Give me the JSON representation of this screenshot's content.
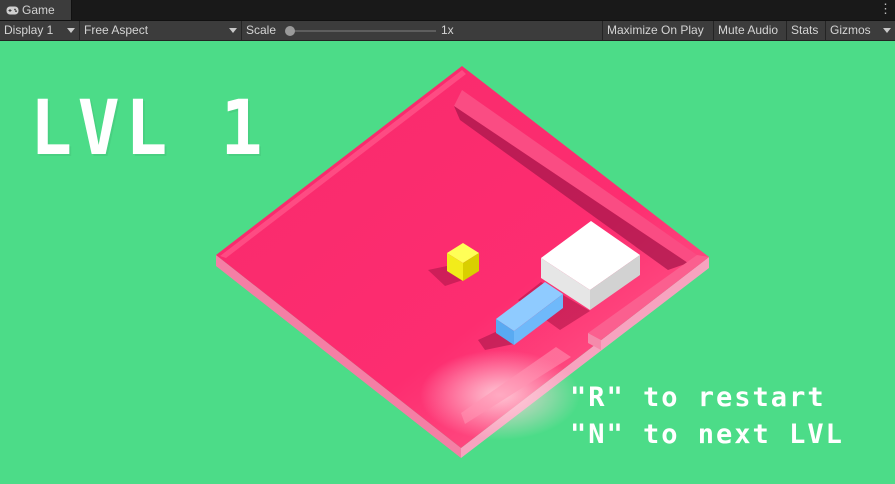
{
  "window": {
    "tab_label": "Game",
    "tab_icon": "gamepad-icon",
    "menu_icon": "kebab-menu-icon"
  },
  "toolbar": {
    "display": "Display 1",
    "aspect": "Free Aspect",
    "scale_label": "Scale",
    "scale_value": "1x",
    "maximize": "Maximize On Play",
    "mute": "Mute Audio",
    "stats": "Stats",
    "gizmos": "Gizmos"
  },
  "game": {
    "level_title": "LVL 1",
    "hint_restart": "\"R\" to restart",
    "hint_next": "\"N\" to next LVL",
    "colors": {
      "background": "#4cdc88",
      "board": "#fb2b6f",
      "player": "#ffffff",
      "coin": "#ffff2a",
      "block": "#7cc6ff"
    }
  }
}
